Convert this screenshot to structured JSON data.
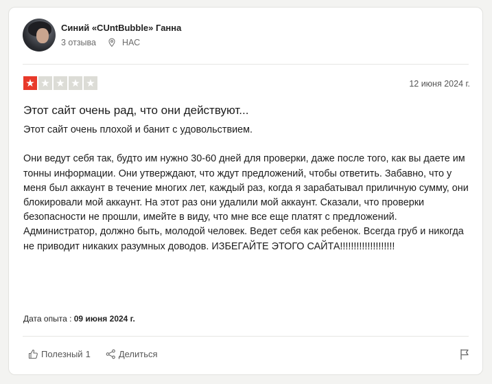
{
  "reviewer": {
    "name": "Синий «CUntBubble» Ганна",
    "reviews_count": "3 отзыва",
    "country": "НАС"
  },
  "review": {
    "rating": 1,
    "max_rating": 5,
    "date": "12 июня 2024 г.",
    "title": "Этот сайт очень рад, что они действуют...",
    "body": "Этот сайт очень плохой и банит с удовольствием.\n\nОни ведут себя так, будто им нужно 30-60 дней для проверки, даже после того, как вы даете им тонны информации. Они утверждают, что ждут предложений, чтобы ответить. Забавно, что у меня был аккаунт в течение многих лет, каждый раз, когда я зарабатывал приличную сумму, они блокировали мой аккаунт. На этот раз они удалили мой аккаунт. Сказали, что проверки безопасности не прошли, имейте в виду, что мне все еще платят с предложений. Администратор, должно быть, молодой человек. Ведет себя как ребенок. Всегда груб и никогда не приводит никаких разумных доводов. ИЗБЕГАЙТЕ ЭТОГО САЙТА!!!!!!!!!!!!!!!!!!!!",
    "experience_label": "Дата опыта :",
    "experience_date": "09 июня 2024 г."
  },
  "actions": {
    "useful_label": "Полезный",
    "useful_count": "1",
    "share_label": "Делиться"
  },
  "icons": {
    "location": "map-pin-icon",
    "like": "thumbs-up-icon",
    "share": "share-icon",
    "report": "flag-icon"
  },
  "colors": {
    "star_active": "#e8392a",
    "star_inactive": "#dcdcd6",
    "card_background": "#ffffff",
    "page_background": "#f3f3f1"
  }
}
